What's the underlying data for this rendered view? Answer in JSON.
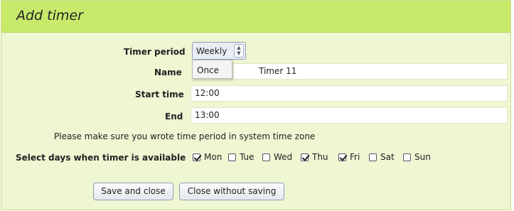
{
  "dialog": {
    "title": "Add timer"
  },
  "form": {
    "timer_period_label": "Timer period",
    "timer_period_value": "Weekly",
    "dropdown_option": "Once",
    "name_label": "Name",
    "name_value": "Timer 11",
    "start_label": "Start time",
    "start_value": "12:00",
    "end_label": "End",
    "end_value": "13:00",
    "notice": "Please make sure you wrote time period in system time zone",
    "days_label": "Select days when timer is available"
  },
  "days": [
    {
      "label": "Mon",
      "checked": true
    },
    {
      "label": "Tue",
      "checked": false
    },
    {
      "label": "Wed",
      "checked": false
    },
    {
      "label": "Thu",
      "checked": true
    },
    {
      "label": "Fri",
      "checked": true
    },
    {
      "label": "Sat",
      "checked": false
    },
    {
      "label": "Sun",
      "checked": false
    }
  ],
  "buttons": {
    "save": "Save and close",
    "cancel": "Close without saving"
  },
  "colors": {
    "title_bar": "#c7ea6b",
    "panel": "#eef6d2"
  }
}
